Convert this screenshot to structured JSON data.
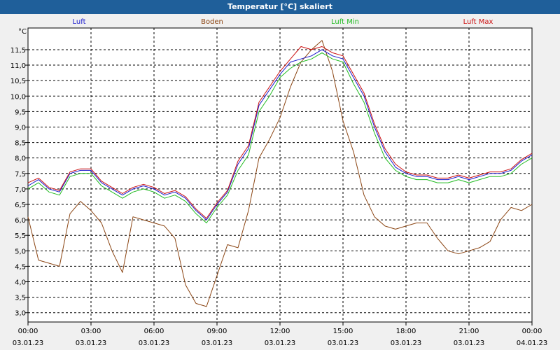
{
  "window": {
    "title": "Temperatur [°C] skaliert"
  },
  "colors": {
    "frame_bg": "#f0f0f0",
    "title_bg": "#1f5f9a",
    "plot_bg": "#ffffff",
    "grid": "#000000"
  },
  "chart_data": {
    "type": "line",
    "title": "Temperatur [°C] skaliert",
    "ylabel": "°C",
    "ylim": [
      2.7,
      12.2
    ],
    "xlim": [
      0,
      24
    ],
    "grid": true,
    "legend_placement": "top",
    "x_ticks": [
      {
        "x": 0,
        "time": "00:00",
        "date": "03.01.23"
      },
      {
        "x": 3,
        "time": "03:00",
        "date": "03.01.23"
      },
      {
        "x": 6,
        "time": "06:00",
        "date": "03.01.23"
      },
      {
        "x": 9,
        "time": "09:00",
        "date": "03.01.23"
      },
      {
        "x": 12,
        "time": "12:00",
        "date": "03.01.23"
      },
      {
        "x": 15,
        "time": "15:00",
        "date": "03.01.23"
      },
      {
        "x": 18,
        "time": "18:00",
        "date": "03.01.23"
      },
      {
        "x": 21,
        "time": "21:00",
        "date": "03.01.23"
      },
      {
        "x": 24,
        "time": "00:00",
        "date": "04.01.23"
      }
    ],
    "y_ticks": [
      "3,0",
      "3,5",
      "4,0",
      "4,5",
      "5,0",
      "5,5",
      "6,0",
      "6,5",
      "7,0",
      "7,5",
      "8,0",
      "8,5",
      "9,0",
      "9,5",
      "10,0",
      "10,5",
      "11,0",
      "11,5"
    ],
    "y_tick_values": [
      3.0,
      3.5,
      4.0,
      4.5,
      5.0,
      5.5,
      6.0,
      6.5,
      7.0,
      7.5,
      8.0,
      8.5,
      9.0,
      9.5,
      10.0,
      10.5,
      11.0,
      11.5
    ],
    "series": [
      {
        "name": "Luft",
        "color": "#1a1acc",
        "x": [
          0,
          0.5,
          1,
          1.5,
          2,
          2.5,
          3,
          3.5,
          4,
          4.5,
          5,
          5.5,
          6,
          6.5,
          7,
          7.5,
          8,
          8.5,
          9,
          9.5,
          10,
          10.5,
          11,
          11.5,
          12,
          12.5,
          13,
          13.5,
          14,
          14.5,
          15,
          15.5,
          16,
          16.5,
          17,
          17.5,
          18,
          18.5,
          19,
          19.5,
          20,
          20.5,
          21,
          21.5,
          22,
          22.5,
          23,
          23.5,
          24
        ],
        "values": [
          7.1,
          7.3,
          7.0,
          6.9,
          7.5,
          7.6,
          7.6,
          7.2,
          7.0,
          6.8,
          7.0,
          7.1,
          7.0,
          6.8,
          6.9,
          6.7,
          6.3,
          6.0,
          6.5,
          6.9,
          7.8,
          8.3,
          9.7,
          10.2,
          10.7,
          11.1,
          11.2,
          11.3,
          11.5,
          11.3,
          11.2,
          10.6,
          10.0,
          9.0,
          8.2,
          7.7,
          7.5,
          7.4,
          7.4,
          7.3,
          7.3,
          7.4,
          7.3,
          7.4,
          7.5,
          7.5,
          7.6,
          7.9,
          8.1
        ]
      },
      {
        "name": "Boden",
        "color": "#8b4513",
        "x": [
          0,
          0.5,
          1,
          1.5,
          2,
          2.5,
          3,
          3.5,
          4,
          4.5,
          5,
          5.5,
          6,
          6.5,
          7,
          7.5,
          8,
          8.5,
          9,
          9.5,
          10,
          10.5,
          11,
          11.5,
          12,
          12.5,
          13,
          13.5,
          14,
          14.5,
          15,
          15.5,
          16,
          16.5,
          17,
          17.5,
          18,
          18.5,
          19,
          19.5,
          20,
          20.5,
          21,
          21.5,
          22,
          22.5,
          23,
          23.5,
          24
        ],
        "values": [
          6.1,
          4.7,
          4.6,
          4.5,
          6.2,
          6.6,
          6.3,
          5.9,
          5.0,
          4.3,
          6.1,
          6.0,
          5.9,
          5.8,
          5.4,
          3.9,
          3.3,
          3.2,
          4.2,
          5.2,
          5.1,
          6.3,
          8.0,
          8.6,
          9.3,
          10.3,
          11.1,
          11.5,
          11.8,
          10.8,
          9.2,
          8.2,
          6.8,
          6.1,
          5.8,
          5.7,
          5.8,
          5.9,
          5.9,
          5.4,
          5.0,
          4.9,
          5.0,
          5.1,
          5.3,
          6.0,
          6.4,
          6.3,
          6.5
        ]
      },
      {
        "name": "Luft Min",
        "color": "#22bb22",
        "x": [
          0,
          0.5,
          1,
          1.5,
          2,
          2.5,
          3,
          3.5,
          4,
          4.5,
          5,
          5.5,
          6,
          6.5,
          7,
          7.5,
          8,
          8.5,
          9,
          9.5,
          10,
          10.5,
          11,
          11.5,
          12,
          12.5,
          13,
          13.5,
          14,
          14.5,
          15,
          15.5,
          16,
          16.5,
          17,
          17.5,
          18,
          18.5,
          19,
          19.5,
          20,
          20.5,
          21,
          21.5,
          22,
          22.5,
          23,
          23.5,
          24
        ],
        "values": [
          7.0,
          7.2,
          6.9,
          6.8,
          7.4,
          7.5,
          7.5,
          7.1,
          6.9,
          6.7,
          6.9,
          7.0,
          6.9,
          6.7,
          6.8,
          6.6,
          6.2,
          5.9,
          6.4,
          6.8,
          7.6,
          8.1,
          9.5,
          10.0,
          10.6,
          10.9,
          11.1,
          11.2,
          11.4,
          11.2,
          11.1,
          10.4,
          9.8,
          8.8,
          8.0,
          7.6,
          7.4,
          7.3,
          7.3,
          7.2,
          7.2,
          7.3,
          7.2,
          7.3,
          7.4,
          7.4,
          7.5,
          7.8,
          8.0
        ]
      },
      {
        "name": "Luft Max",
        "color": "#cc1111",
        "x": [
          0,
          0.5,
          1,
          1.5,
          2,
          2.5,
          3,
          3.5,
          4,
          4.5,
          5,
          5.5,
          6,
          6.5,
          7,
          7.5,
          8,
          8.5,
          9,
          9.5,
          10,
          10.5,
          11,
          11.5,
          12,
          12.5,
          13,
          13.5,
          14,
          14.5,
          15,
          15.5,
          16,
          16.5,
          17,
          17.5,
          18,
          18.5,
          19,
          19.5,
          20,
          20.5,
          21,
          21.5,
          22,
          22.5,
          23,
          23.5,
          24
        ],
        "values": [
          7.2,
          7.35,
          7.05,
          6.95,
          7.55,
          7.65,
          7.65,
          7.25,
          7.05,
          6.85,
          7.05,
          7.15,
          7.05,
          6.85,
          6.95,
          6.75,
          6.35,
          6.05,
          6.55,
          6.95,
          7.9,
          8.4,
          9.8,
          10.3,
          10.8,
          11.2,
          11.6,
          11.5,
          11.6,
          11.4,
          11.3,
          10.7,
          10.1,
          9.1,
          8.3,
          7.8,
          7.55,
          7.45,
          7.45,
          7.35,
          7.35,
          7.45,
          7.35,
          7.45,
          7.55,
          7.55,
          7.65,
          7.95,
          8.15
        ]
      }
    ]
  }
}
